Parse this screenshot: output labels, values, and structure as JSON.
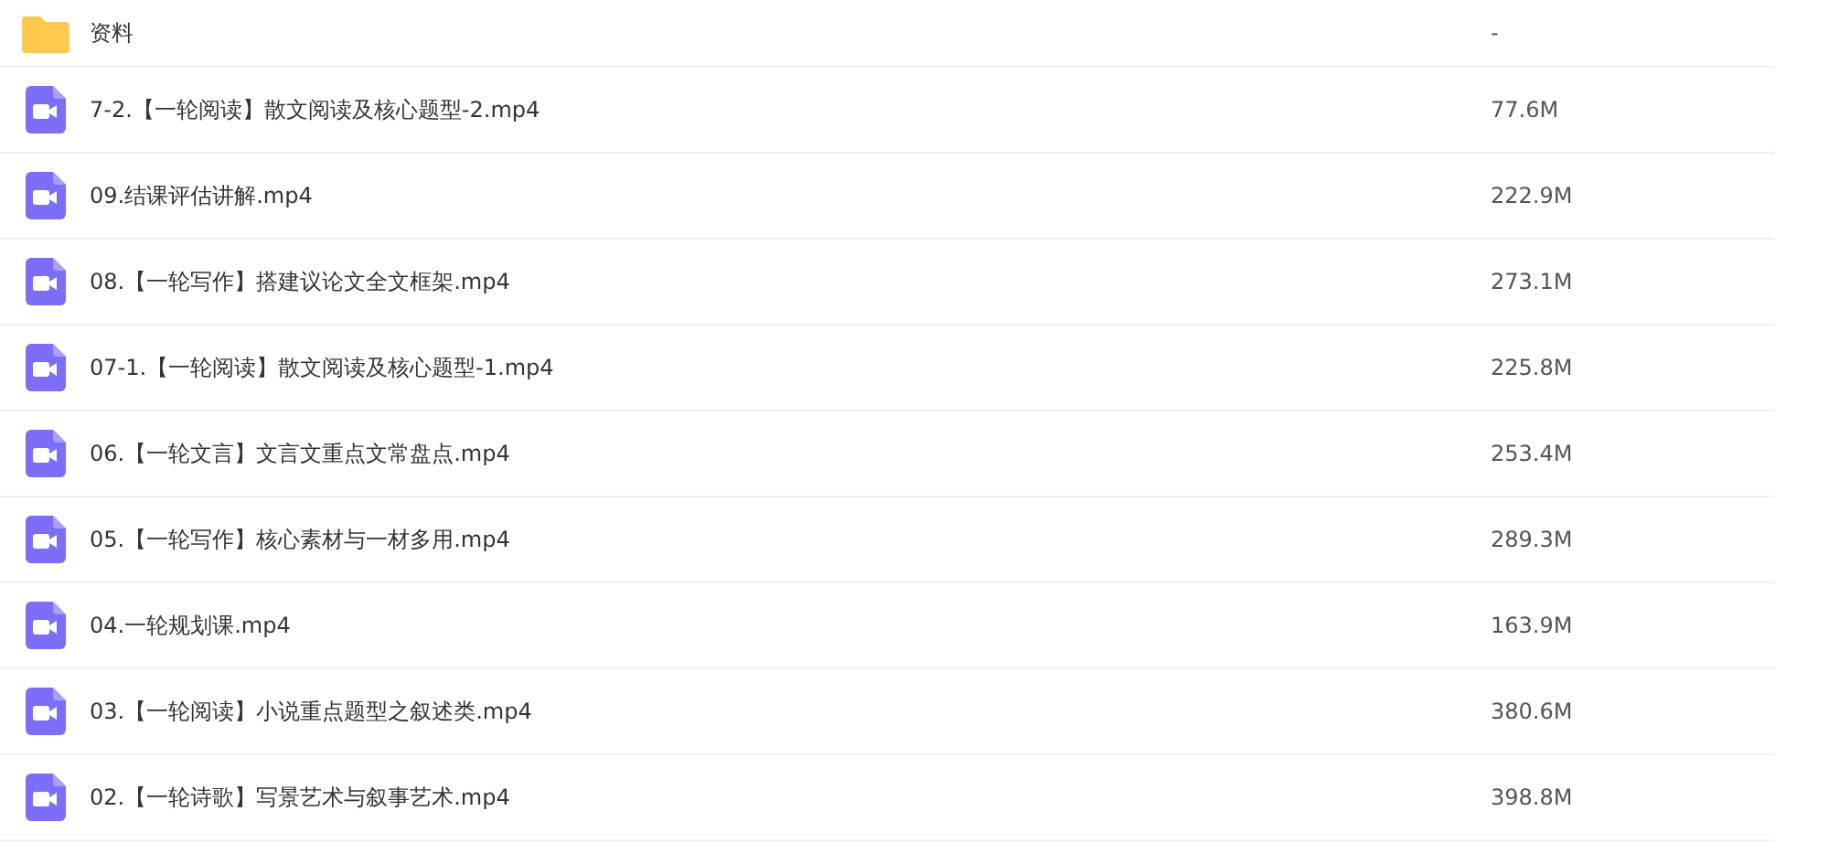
{
  "files": [
    {
      "kind": "folder",
      "name": "资料",
      "size": "-"
    },
    {
      "kind": "video",
      "name": "7-2.【一轮阅读】散文阅读及核心题型-2.mp4",
      "size": "77.6M"
    },
    {
      "kind": "video",
      "name": "09.结课评估讲解.mp4",
      "size": "222.9M"
    },
    {
      "kind": "video",
      "name": "08.【一轮写作】搭建议论文全文框架.mp4",
      "size": "273.1M"
    },
    {
      "kind": "video",
      "name": "07-1.【一轮阅读】散文阅读及核心题型-1.mp4",
      "size": "225.8M"
    },
    {
      "kind": "video",
      "name": "06.【一轮文言】文言文重点文常盘点.mp4",
      "size": "253.4M"
    },
    {
      "kind": "video",
      "name": "05.【一轮写作】核心素材与一材多用.mp4",
      "size": "289.3M"
    },
    {
      "kind": "video",
      "name": "04.一轮规划课.mp4",
      "size": "163.9M"
    },
    {
      "kind": "video",
      "name": "03.【一轮阅读】小说重点题型之叙述类.mp4",
      "size": "380.6M"
    },
    {
      "kind": "video",
      "name": "02.【一轮诗歌】写景艺术与叙事艺术.mp4",
      "size": "398.8M"
    }
  ]
}
